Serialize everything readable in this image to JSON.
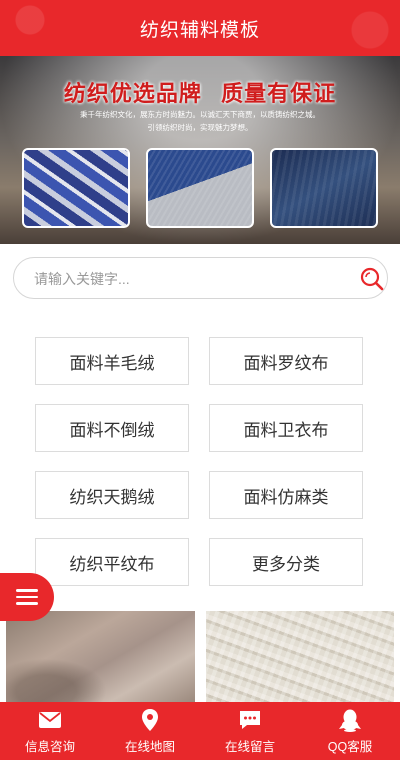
{
  "header": {
    "title": "纺织辅料模板"
  },
  "banner": {
    "heading_left": "纺织优选品牌",
    "heading_right": "质量有保证",
    "subtext_line1": "秉千年纺织文化，展东方时尚魅力。以诚汇天下商贾，以质铸纺织之城。",
    "subtext_line2": "引领纺织时尚，实现魅力梦想。"
  },
  "search": {
    "placeholder": "请输入关键字..."
  },
  "categories": [
    "面料羊毛绒",
    "面料罗纹布",
    "面料不倒绒",
    "面料卫衣布",
    "纺织天鹅绒",
    "面料仿麻类",
    "纺织平纹布",
    "更多分类"
  ],
  "tabbar": [
    {
      "label": "信息咨询",
      "icon": "mail-icon"
    },
    {
      "label": "在线地图",
      "icon": "map-pin-icon"
    },
    {
      "label": "在线留言",
      "icon": "chat-icon"
    },
    {
      "label": "QQ客服",
      "icon": "qq-penguin-icon"
    }
  ],
  "colors": {
    "accent": "#e8282b",
    "banner_heading": "#d01d1d"
  }
}
